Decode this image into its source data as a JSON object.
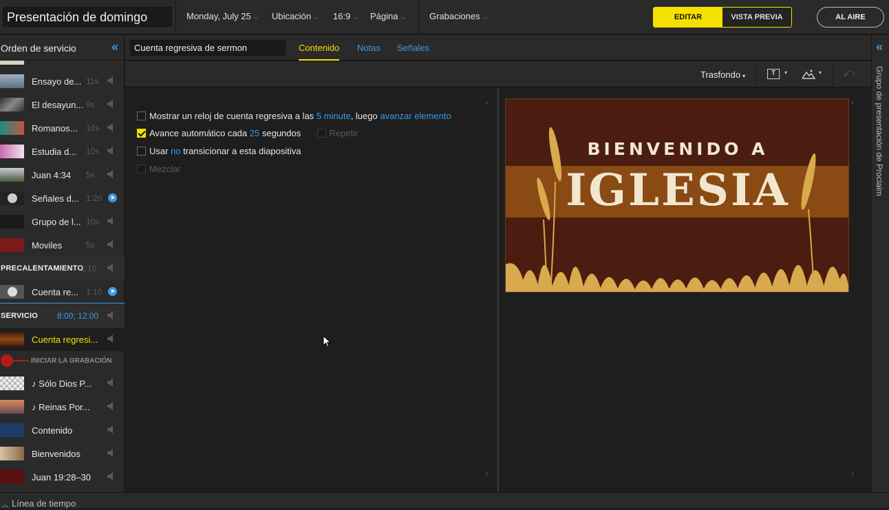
{
  "header": {
    "title": "Presentación de domingo",
    "date": "Monday, July 25",
    "ubicacion": "Ubicación",
    "aspect": "16:9",
    "pagina": "Página",
    "grabaciones": "Grabaciones",
    "editar": "EDITAR",
    "vista_previa": "VISTA PREVIA",
    "al_aire": "AL AIRE"
  },
  "sidebar": {
    "title": "Orden de servicio",
    "items": [
      {
        "name": "Ensayo de...",
        "dur": "11s"
      },
      {
        "name": "El desayun...",
        "dur": "9s"
      },
      {
        "name": "Romanos...",
        "dur": "10s"
      },
      {
        "name": "Estudia d...",
        "dur": "10s"
      },
      {
        "name": "Juan 4:34",
        "dur": "5s"
      },
      {
        "name": "Señales d...",
        "dur": "1:20"
      },
      {
        "name": "Grupo de l...",
        "dur": "10s"
      },
      {
        "name": "Moviles",
        "dur": "5s"
      }
    ],
    "precalentamiento": {
      "label": "PRECALENTAMIENTO",
      "dur": "1:10"
    },
    "cuenta_re": {
      "name": "Cuenta re...",
      "dur": "1:10"
    },
    "servicio": {
      "label": "SERVICIO",
      "times": "8:00; 12:00"
    },
    "cuenta_regresi": {
      "name": "Cuenta regresi..."
    },
    "iniciar": "INICIAR LA GRABACIÓN",
    "songs": [
      {
        "name": "Sólo Dios P..."
      },
      {
        "name": "Reinas Por..."
      }
    ],
    "tail": [
      {
        "name": "Contenido"
      },
      {
        "name": "Bienvenidos"
      },
      {
        "name": "Juan 19:28–30"
      }
    ]
  },
  "editor": {
    "item_name": "Cuenta regresiva de sermon",
    "tabs": [
      "Contenido",
      "Notas",
      "Señales"
    ],
    "trasfondo": "Trasfondo",
    "opt1_pre": "Mostrar un reloj de cuenta regresiva a las",
    "opt1_val": "5 minute",
    "opt1_mid": ", luego",
    "opt1_link": "avanzar elemento",
    "opt2_pre": "Avance automático cada",
    "opt2_val": "25",
    "opt2_post": "segundos",
    "repetir": "Repetir",
    "opt3_pre": "Usar",
    "opt3_val": "no",
    "opt3_post": "transicionar a esta diapositiva",
    "mezclar": "Mezclar"
  },
  "slide": {
    "line1": "BIENVENIDO A",
    "line2": "IGLESIA"
  },
  "rightbar": {
    "label": "Grupo de presentación de Proclaim"
  },
  "footer": {
    "label": "Línea de tiempo"
  },
  "colors": {
    "accent": "#f5e100",
    "link": "#3c9be6"
  }
}
